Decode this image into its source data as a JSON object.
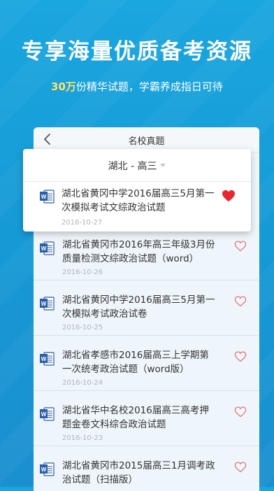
{
  "hero": {
    "title": "专享海量优质备考资源",
    "sub_highlight": "30万",
    "sub_rest": "份精华试题，学霸养成指日可待"
  },
  "app": {
    "title": "名校真题",
    "filter": "湖北 - 高三"
  },
  "featured": {
    "title": "湖北省黄冈中学2016届高三5月第一次模拟考试文综政治试题",
    "date": "2016-10-27",
    "favorited": true
  },
  "items": [
    {
      "title": "湖北省黄冈市2016年高三年级3月份质量检测文综政治试题（word）",
      "date": "2016-10-26"
    },
    {
      "title": "湖北省黄冈中学2016届高三5月第一次模拟考试政治试卷",
      "date": "2016-10-25"
    },
    {
      "title": "湖北省孝感市2016届高三上学期第一次统考政治试题（word版）",
      "date": "2016-10-24"
    },
    {
      "title": "湖北省华中名校2016届高三高考押题金卷文科综合政治试题",
      "date": "2016-10-23"
    },
    {
      "title": "湖北省黄冈市2015届高三1月调考政治试题（扫描版）",
      "date": ""
    }
  ],
  "colors": {
    "background": "#1698d4",
    "highlight": "#ffe36a",
    "heart_filled": "#e8262d",
    "heart_outline": "#e4686c",
    "word_icon": "#2b5fa8"
  }
}
